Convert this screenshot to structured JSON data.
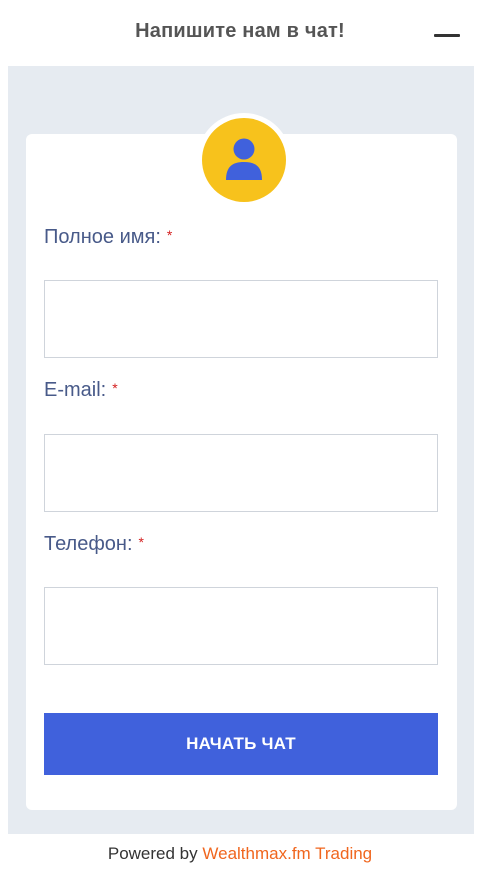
{
  "header": {
    "title": "Напишите нам в чат!",
    "minimize_icon": "minus-icon"
  },
  "form": {
    "avatar_icon": "user-icon",
    "fields": [
      {
        "label": "Полное имя:",
        "required_mark": "*",
        "value": "",
        "placeholder": ""
      },
      {
        "label": "E-mail:",
        "required_mark": "*",
        "value": "",
        "placeholder": ""
      },
      {
        "label": "Телефон:",
        "required_mark": "*",
        "value": "",
        "placeholder": ""
      }
    ],
    "submit_label": "НАЧАТЬ ЧАТ"
  },
  "footer": {
    "powered_by": "Powered by",
    "brand": "Wealthmax.fm Trading"
  },
  "colors": {
    "accent": "#4061dc",
    "avatar": "#f7c21c",
    "label": "#485a89",
    "required": "#d42020",
    "brand_link": "#f0661e",
    "panel_bg": "#e6ebf1"
  }
}
